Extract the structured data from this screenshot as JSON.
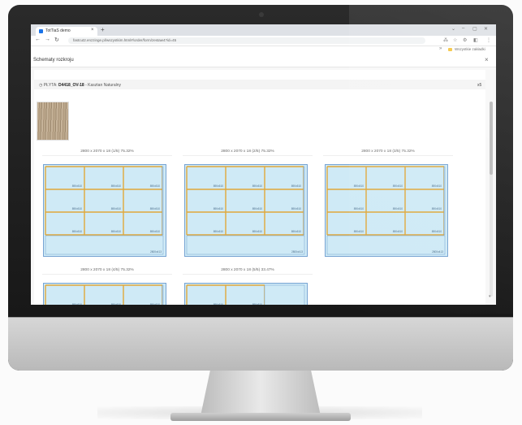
{
  "browser": {
    "tab_title": "TotTiaS demo",
    "new_tab": "+",
    "url": "fastcut2.enzzinge.pl/wszystkim.html#/order/form/zestaw4?id=45",
    "bookmarks_label": "Wszystkie zakładki",
    "window_controls": [
      "⌄",
      "–",
      "▢",
      "✕"
    ]
  },
  "modal": {
    "title": "Schematy rozkroju",
    "close": "×"
  },
  "plate": {
    "icon": "clock-icon",
    "prefix": "PŁYTA:",
    "code": "D4418_OV-18",
    "name": "- Kasztan Naturalny",
    "count": "x5"
  },
  "sheets": [
    {
      "caption": "2800 x 2070 x 18  (1/5)  75.32%",
      "waste_label": "2800x413"
    },
    {
      "caption": "2800 x 2070 x 18  (2/5)  75.32%",
      "waste_label": "2800x413"
    },
    {
      "caption": "2800 x 2070 x 18  (3/5)  75.32%",
      "waste_label": "2800x413"
    },
    {
      "caption": "2800 x 2070 x 18  (4/5)  75.32%",
      "waste_label": ""
    },
    {
      "caption": "2800 x 2070 x 18  (5/5)  33.47%",
      "waste_label": ""
    }
  ],
  "part_label": "890x510",
  "colors": {
    "part_fill": "#cfeaf6",
    "cut_line": "#e0a83a",
    "sheet_border": "#5b8fc9"
  }
}
